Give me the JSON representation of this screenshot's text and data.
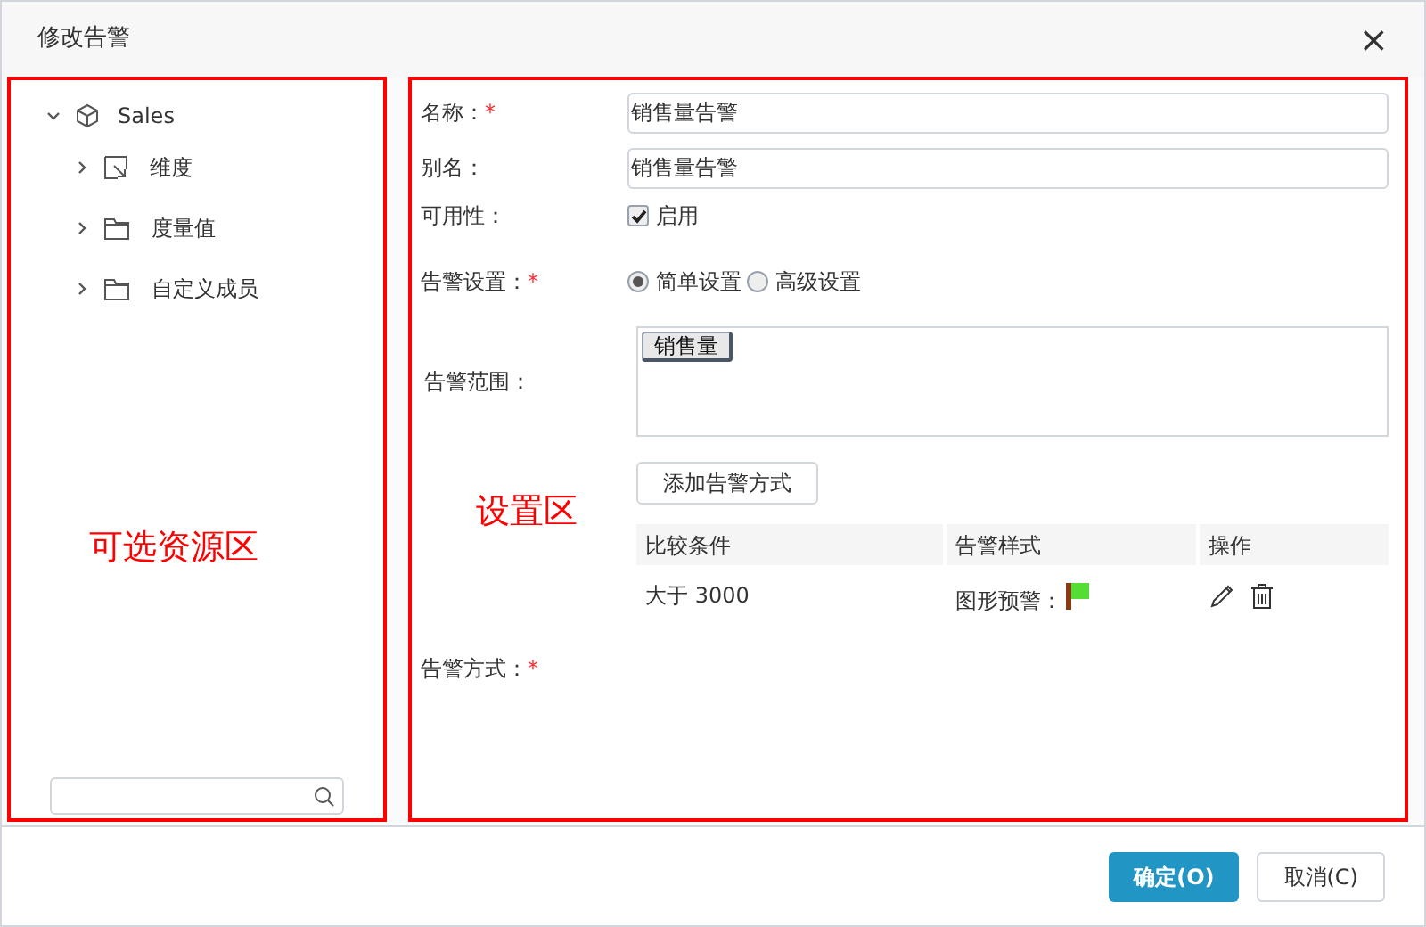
{
  "dialog": {
    "title": "修改告警",
    "close": "×"
  },
  "tree": {
    "root": {
      "label": "Sales",
      "expanded": true,
      "children": [
        {
          "label": "维度",
          "kind": "dimension",
          "expanded": false
        },
        {
          "label": "度量值",
          "kind": "folder",
          "expanded": false
        },
        {
          "label": "自定义成员",
          "kind": "folder",
          "expanded": false
        }
      ]
    },
    "annotation": "可选资源区"
  },
  "form": {
    "annotation": "设置区",
    "name": {
      "label": "名称：",
      "required_mark": "*",
      "value": "销售量告警"
    },
    "alias": {
      "label": "别名：",
      "value": "销售量告警"
    },
    "availability": {
      "label": "可用性：",
      "option": "启用",
      "checked": true
    },
    "setting": {
      "label": "告警设置：",
      "required_mark": "*",
      "options": [
        {
          "label": "简单设置",
          "selected": true
        },
        {
          "label": "高级设置",
          "selected": false
        }
      ]
    },
    "range": {
      "label": "告警范围：",
      "tags": [
        "销售量"
      ]
    },
    "add_button": "添加告警方式",
    "table": {
      "columns": [
        "比较条件",
        "告警样式",
        "操作"
      ],
      "rows": [
        {
          "condition": "大于 3000",
          "style": "图形预警："
        }
      ]
    },
    "method": {
      "label": "告警方式：",
      "required_mark": "*"
    }
  },
  "buttons": [
    {
      "label": "确定(O)",
      "primary": true
    },
    {
      "label": "取消(C)",
      "primary": false
    }
  ]
}
